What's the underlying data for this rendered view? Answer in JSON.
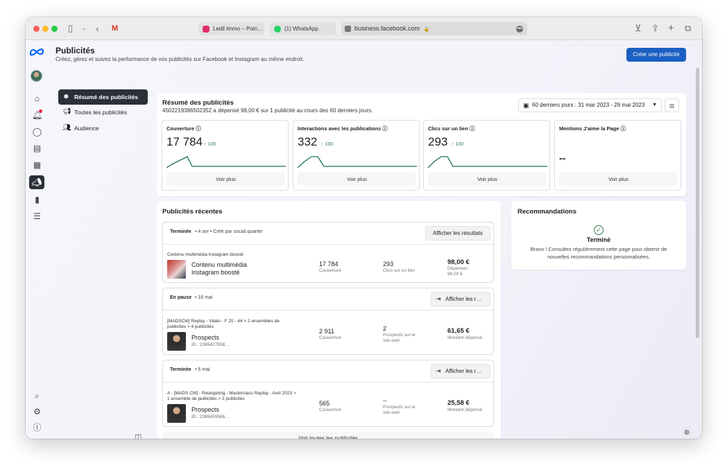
{
  "browser": {
    "tabs": [
      {
        "label": "Ledil Immo – Poin…",
        "color": "#e1306c"
      },
      {
        "label": "(1) WhatsApp",
        "color": "#25d366"
      }
    ],
    "url": "business.facebook.com"
  },
  "header": {
    "title": "Publicités",
    "subtitle": "Créez, gérez et suivez la performance de vos publicités sur Facebook et Instagram au même endroit.",
    "create_button": "Créer une publicité"
  },
  "subnav": [
    {
      "label": "Résumé des publicités",
      "icon": "smile-icon",
      "active": true
    },
    {
      "label": "Toutes les publicités",
      "icon": "megaphone-icon",
      "active": false
    },
    {
      "label": "Audience",
      "icon": "people-icon",
      "active": false
    }
  ],
  "summary": {
    "title": "Résumé des publicités",
    "description": "4502219386502352 a dépensé 98,00 € sur 1 publicité au cours des 60 derniers jours.",
    "date_range": "60 derniers jours : 31 mar 2023 - 29 mai 2023",
    "metrics": [
      {
        "title": "Couverture",
        "value": "17 784",
        "delta": "100",
        "more": "Voir plus"
      },
      {
        "title": "Interactions avec les publications",
        "value": "332",
        "delta": "100",
        "more": "Voir plus"
      },
      {
        "title": "Clics sur un lien",
        "value": "293",
        "delta": "100",
        "more": "Voir plus"
      },
      {
        "title": "Mentions J'aime la Page",
        "value": "--",
        "delta": "",
        "more": "Voir plus"
      }
    ]
  },
  "recent": {
    "title": "Publicités récentes",
    "ads": [
      {
        "status": "Terminée",
        "date": "4 avr • Créé par social.quarter",
        "button": "Afficher les résultats",
        "name": "Contenu multimédia Instagram boosté",
        "title": "Contenu multimédia Instagram boosté",
        "id": "",
        "reach": "17 784",
        "reach_label": "Couverture",
        "result": "293",
        "result_label": "Clics sur un lien",
        "amount": "98,00 €",
        "amount_label": "Dépenses : 98,00 €"
      },
      {
        "status": "En pause",
        "date": "16 mai",
        "button": "Afficher les r…",
        "name": "[MADSCM] Replay - Vidéo - F 25 - 44 > 2 ensembles de publicités > 4 publicités",
        "title": "Prospects",
        "id": "ID : 2385427938…",
        "reach": "2 911",
        "reach_label": "Couverture",
        "result": "2",
        "result_label": "Prospects sur le site web",
        "amount": "61,65 €",
        "amount_label": "Montant dépensé"
      },
      {
        "status": "Terminée",
        "date": "5 mai",
        "button": "Afficher les r…",
        "name": "A - [MADS CM] - Retargeting - Masterclass Replay - Avril 2023 > 1 ensemble de publicités > 2 publicités",
        "title": "Prospects",
        "id": "ID : 2385409566…",
        "reach": "565",
        "reach_label": "Couverture",
        "result": "--",
        "result_label": "Prospects sur le site web",
        "amount": "25,58 €",
        "amount_label": "Montant dépensé"
      }
    ],
    "see_all": "Voir toutes les publicités"
  },
  "recommendations": {
    "title": "Recommandations",
    "status": "Terminé",
    "message": "Bravo ! Consultez régulièrement cette page pour obtenir de nouvelles recommandations personnalisées."
  },
  "colors": {
    "primary": "#1a5fc2",
    "sparkline": "#1b6f5f",
    "active_nav": "#2a2f38",
    "positive": "#2d7a4f"
  }
}
